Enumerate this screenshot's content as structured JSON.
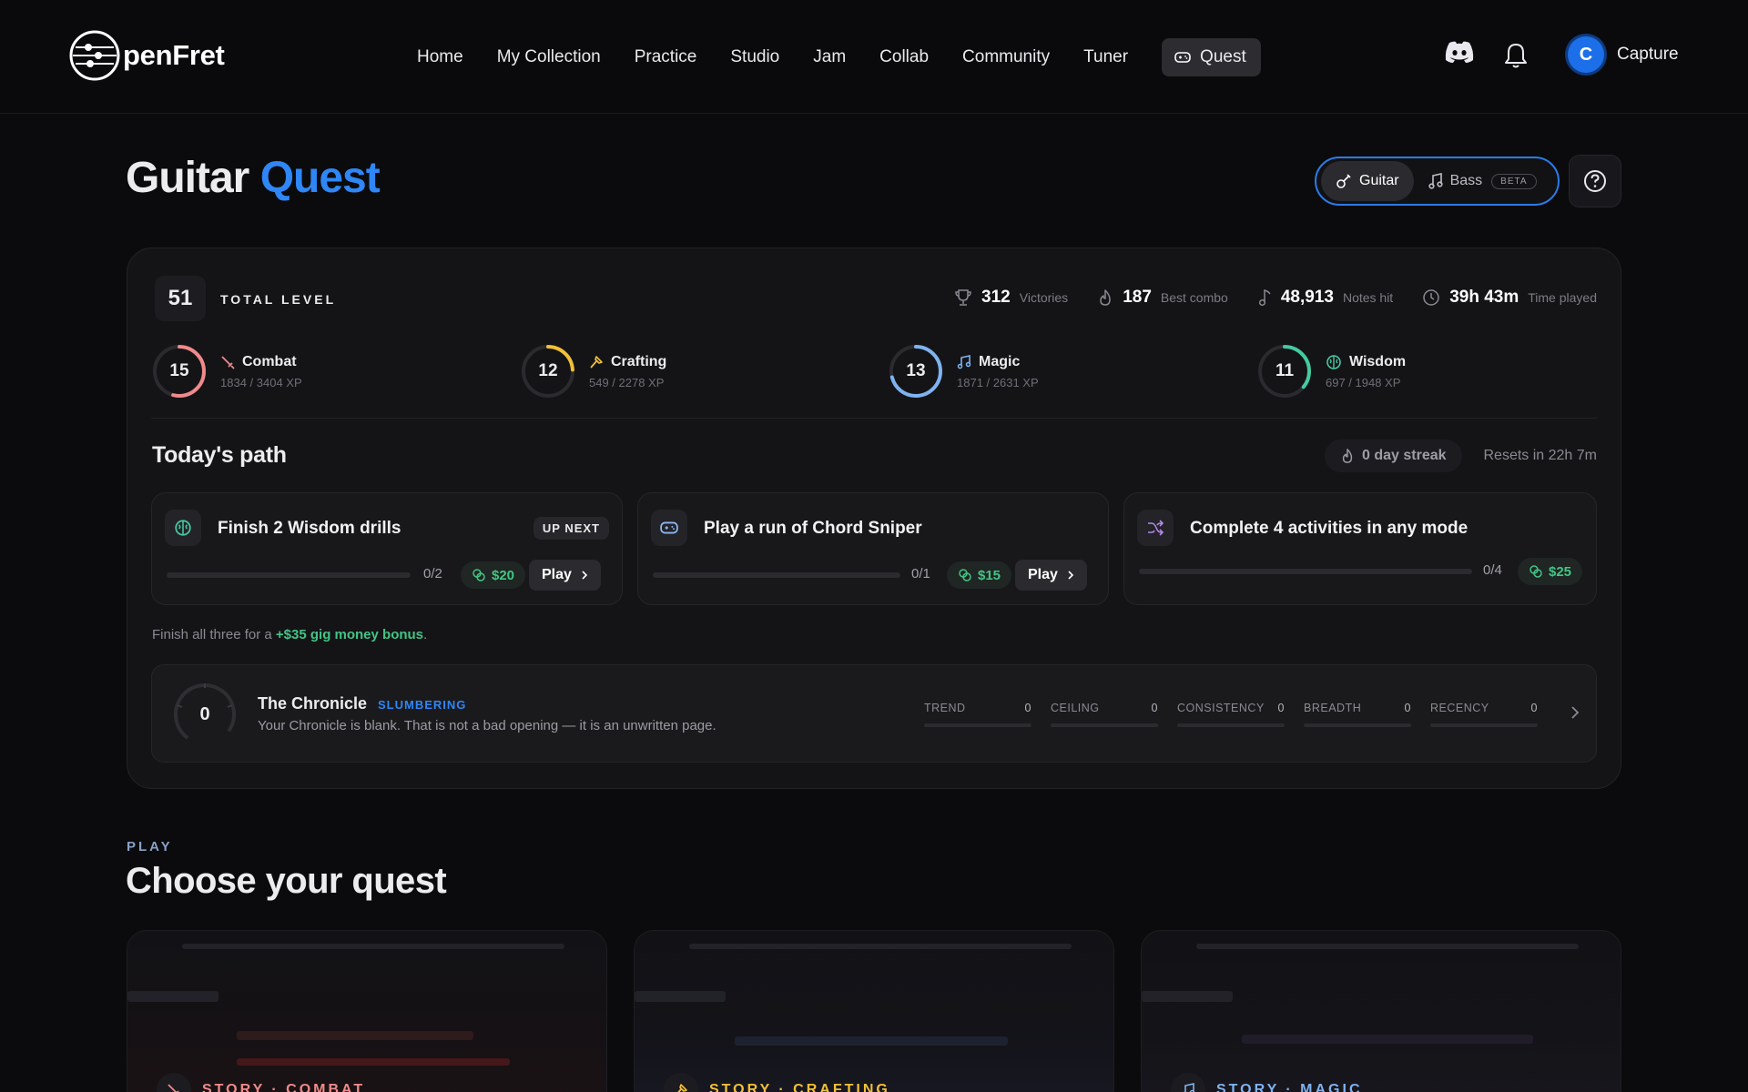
{
  "app": {
    "logo_text": "penFret"
  },
  "nav": {
    "items": [
      "Home",
      "My Collection",
      "Practice",
      "Studio",
      "Jam",
      "Collab",
      "Community",
      "Tuner"
    ],
    "active": "Quest"
  },
  "user": {
    "initial": "C",
    "name": "Capture"
  },
  "page": {
    "title_main": "Guitar",
    "title_accent": "Quest"
  },
  "instrument": {
    "guitar": "Guitar",
    "bass": "Bass",
    "beta": "BETA"
  },
  "level": {
    "value": "51",
    "label": "TOTAL LEVEL"
  },
  "stats": [
    {
      "icon": "trophy-icon",
      "value": "312",
      "label": "Victories"
    },
    {
      "icon": "flame-icon",
      "value": "187",
      "label": "Best combo"
    },
    {
      "icon": "music-note-icon",
      "value": "48,913",
      "label": "Notes hit"
    },
    {
      "icon": "clock-icon",
      "value": "39h 43m",
      "label": "Time played"
    }
  ],
  "skills": [
    {
      "level": "15",
      "name": "Combat",
      "xp": "1834 / 3404 XP",
      "progress": 0.54,
      "color": "#f08a8a",
      "icon": "sword-icon"
    },
    {
      "level": "12",
      "name": "Crafting",
      "xp": "549 / 2278 XP",
      "progress": 0.24,
      "color": "#f2c037",
      "icon": "hammer-icon"
    },
    {
      "level": "13",
      "name": "Magic",
      "xp": "1871 / 2631 XP",
      "progress": 0.71,
      "color": "#7fb2f0",
      "icon": "music-note-icon"
    },
    {
      "level": "11",
      "name": "Wisdom",
      "xp": "697 / 1948 XP",
      "progress": 0.36,
      "color": "#46c9a0",
      "icon": "brain-icon"
    }
  ],
  "today": {
    "title": "Today's path",
    "streak": "0 day streak",
    "resets": "Resets in 22h 7m",
    "tasks": [
      {
        "title": "Finish 2 Wisdom drills",
        "badge": "UP NEXT",
        "count": "0/2",
        "reward": "$20",
        "action": "Play",
        "icon": "brain-icon"
      },
      {
        "title": "Play a run of Chord Sniper",
        "count": "0/1",
        "reward": "$15",
        "action": "Play",
        "icon": "gamepad-icon"
      },
      {
        "title": "Complete 4 activities in any mode",
        "count": "0/4",
        "reward": "$25",
        "icon": "shuffle-icon"
      }
    ],
    "bonus_prefix": "Finish all three for a ",
    "bonus_value": "+$35 gig money bonus",
    "bonus_suffix": "."
  },
  "chronicle": {
    "score": "0",
    "title": "The Chronicle",
    "status": "SLUMBERING",
    "text": "Your Chronicle is blank. That is not a bad opening — it is an unwritten page.",
    "metrics": [
      {
        "label": "TREND",
        "value": "0"
      },
      {
        "label": "CEILING",
        "value": "0"
      },
      {
        "label": "CONSISTENCY",
        "value": "0"
      },
      {
        "label": "BREADTH",
        "value": "0"
      },
      {
        "label": "RECENCY",
        "value": "0"
      }
    ]
  },
  "play": {
    "kicker": "PLAY",
    "title": "Choose your quest",
    "cards": [
      {
        "label": "STORY · COMBAT",
        "color": "#f08a8a",
        "icon": "sword-icon"
      },
      {
        "label": "STORY · CRAFTING",
        "color": "#f2c037",
        "icon": "hammer-icon"
      },
      {
        "label": "STORY · MAGIC",
        "color": "#7fb2f0",
        "icon": "music-note-icon"
      }
    ]
  },
  "colors": {
    "accent": "#2f86f6",
    "money": "#43c485",
    "background": "#0b0b0d"
  }
}
